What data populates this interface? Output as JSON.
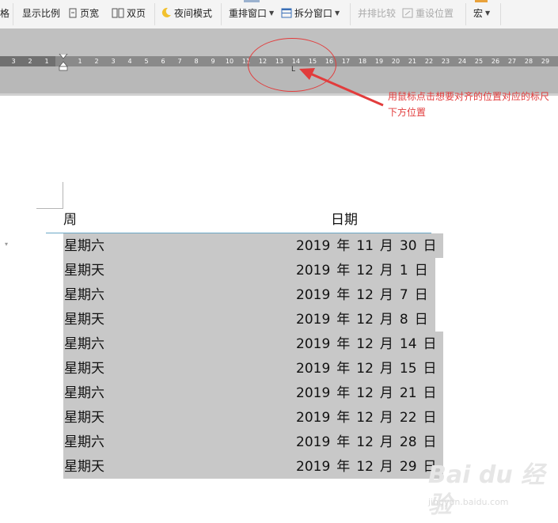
{
  "toolbar": {
    "partial": "格",
    "zoom": "显示比例",
    "page_width": "页宽",
    "double_page": "双页",
    "night_mode": "夜间模式",
    "arrange_window": "重排窗口",
    "split_window": "拆分窗口",
    "side_by_side": "并排比较",
    "reset_position": "重设位置",
    "macro": "宏"
  },
  "ruler": {
    "left_ticks": [
      "3",
      "2",
      "1"
    ],
    "right_ticks": [
      "1",
      "2",
      "3",
      "4",
      "5",
      "6",
      "7",
      "8",
      "9",
      "10",
      "11",
      "12",
      "13",
      "14",
      "15",
      "16",
      "17",
      "18",
      "19",
      "20",
      "21",
      "22",
      "23",
      "24",
      "25",
      "26",
      "27",
      "28",
      "29"
    ],
    "tab_marker": "L"
  },
  "annotation": {
    "text": "用鼠标点击想要对齐的位置对应的标尺下方位置",
    "color": "#e23c3c"
  },
  "table": {
    "header": {
      "week": "周",
      "date": "日期"
    },
    "rows": [
      {
        "week": "星期六",
        "year": "2019",
        "y": "年",
        "month": "11",
        "m": "月",
        "day": "30",
        "d": "日"
      },
      {
        "week": "星期天",
        "year": "2019",
        "y": "年",
        "month": "12",
        "m": "月",
        "day": "1",
        "d": "日"
      },
      {
        "week": "星期六",
        "year": "2019",
        "y": "年",
        "month": "12",
        "m": "月",
        "day": "7",
        "d": "日"
      },
      {
        "week": "星期天",
        "year": "2019",
        "y": "年",
        "month": "12",
        "m": "月",
        "day": "8",
        "d": "日"
      },
      {
        "week": "星期六",
        "year": "2019",
        "y": "年",
        "month": "12",
        "m": "月",
        "day": "14",
        "d": "日"
      },
      {
        "week": "星期天",
        "year": "2019",
        "y": "年",
        "month": "12",
        "m": "月",
        "day": "15",
        "d": "日"
      },
      {
        "week": "星期六",
        "year": "2019",
        "y": "年",
        "month": "12",
        "m": "月",
        "day": "21",
        "d": "日"
      },
      {
        "week": "星期天",
        "year": "2019",
        "y": "年",
        "month": "12",
        "m": "月",
        "day": "22",
        "d": "日"
      },
      {
        "week": "星期六",
        "year": "2019",
        "y": "年",
        "month": "12",
        "m": "月",
        "day": "28",
        "d": "日"
      },
      {
        "week": "星期天",
        "year": "2019",
        "y": "年",
        "month": "12",
        "m": "月",
        "day": "29",
        "d": "日"
      }
    ],
    "selection_color": "#c8c8c8"
  },
  "watermark": {
    "brand": "Bai du 经验",
    "sub": "jingyan.baidu.com"
  }
}
